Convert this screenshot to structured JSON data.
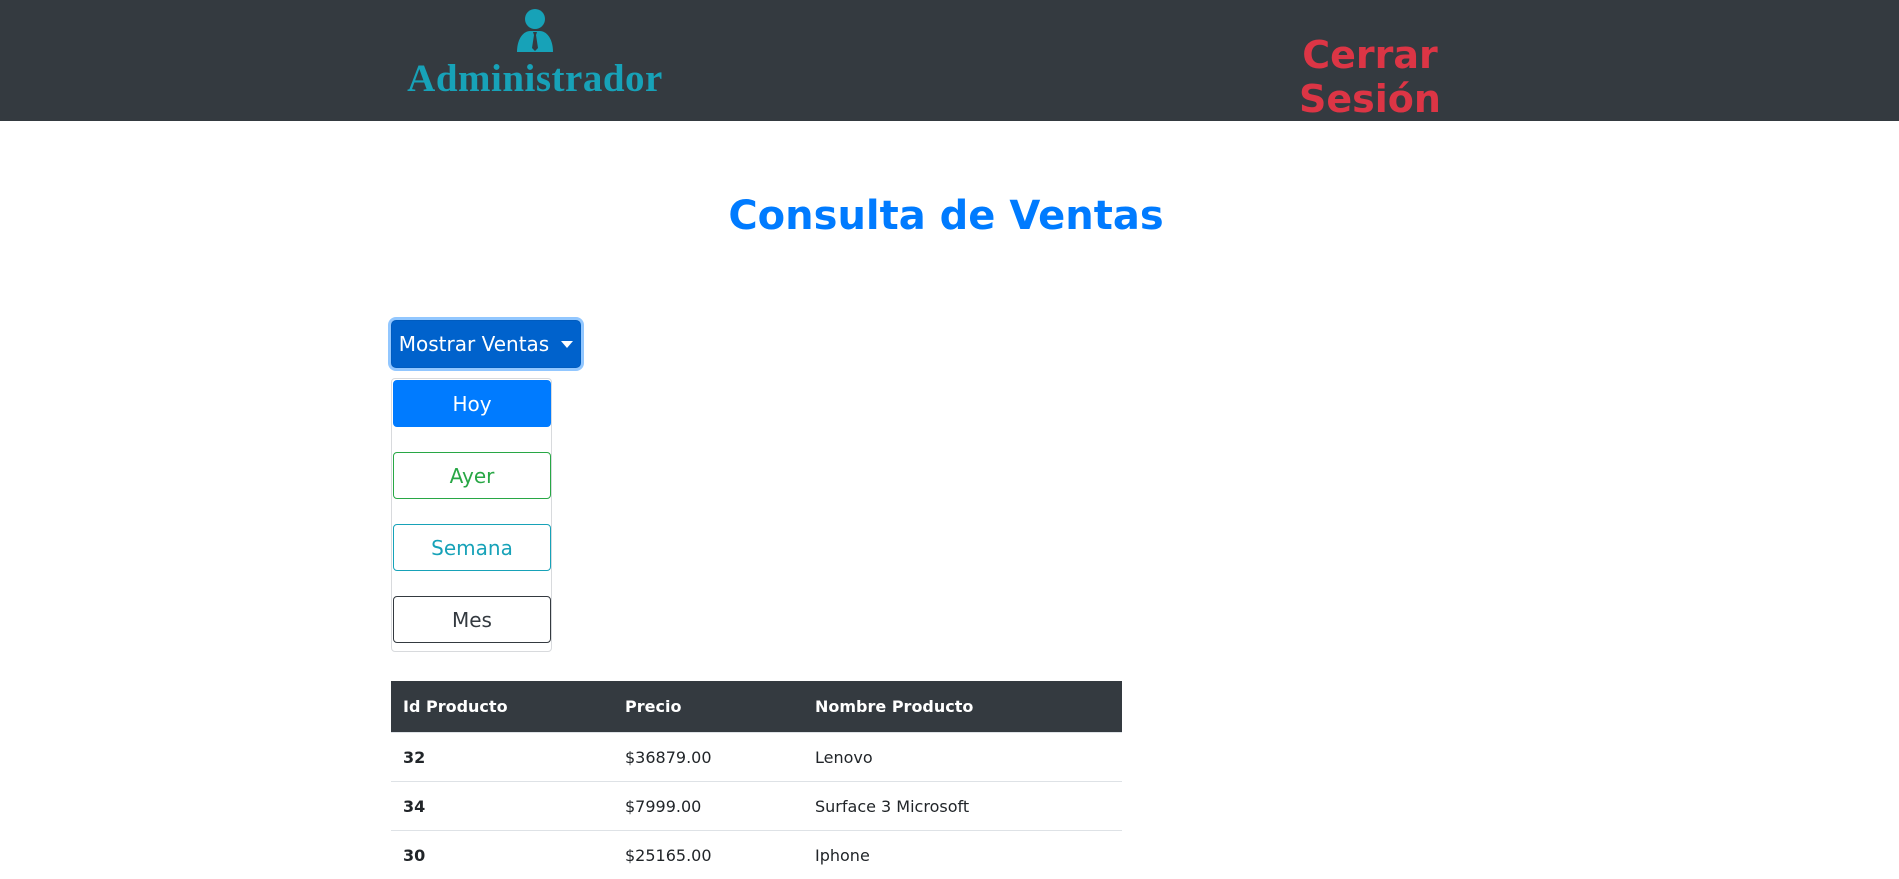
{
  "header": {
    "user_label": "Administrador",
    "user_icon": "user-tie-icon",
    "logout_label": "Cerrar Sesión"
  },
  "page": {
    "title": "Consulta de Ventas"
  },
  "dropdown": {
    "toggle_label": "Mostrar Ventas",
    "items": [
      {
        "label": "Hoy"
      },
      {
        "label": "Ayer"
      },
      {
        "label": "Semana"
      },
      {
        "label": "Mes"
      }
    ]
  },
  "table": {
    "headers": [
      "Id Producto",
      "Precio",
      "Nombre Producto"
    ],
    "rows": [
      {
        "id": "32",
        "price": "$36879.00",
        "name": "Lenovo"
      },
      {
        "id": "34",
        "price": "$7999.00",
        "name": "Surface 3 Microsoft"
      },
      {
        "id": "30",
        "price": "$25165.00",
        "name": "Iphone"
      }
    ]
  },
  "colors": {
    "navbar": "#343a40",
    "admin_teal": "#17a2b8",
    "logout_red": "#dc3545",
    "title_blue": "#007bff",
    "success_green": "#28a745"
  }
}
